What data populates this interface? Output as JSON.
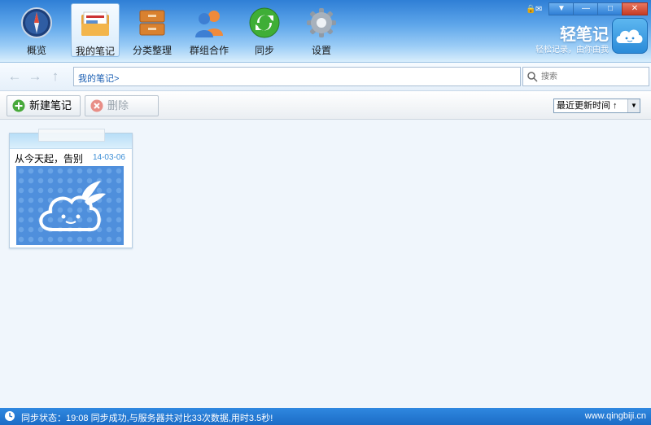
{
  "toolbar": {
    "items": [
      {
        "label": "概览",
        "icon": "compass-icon"
      },
      {
        "label": "我的笔记",
        "icon": "notes-folder-icon"
      },
      {
        "label": "分类整理",
        "icon": "cabinet-icon"
      },
      {
        "label": "群组合作",
        "icon": "group-icon"
      },
      {
        "label": "同步",
        "icon": "sync-icon"
      },
      {
        "label": "设置",
        "icon": "gear-icon"
      }
    ],
    "active_index": 1
  },
  "brand": {
    "title": "轻笔记",
    "slogan": "轻松记录，由你由我"
  },
  "window": {
    "controls": [
      "lock",
      "dropdown",
      "minimize",
      "maximize",
      "close"
    ],
    "accent": "#2f7fd6"
  },
  "nav": {
    "breadcrumb": "我的笔记>",
    "search_placeholder": "搜索"
  },
  "actions": {
    "new_note": "新建笔记",
    "delete": "删除",
    "sort_value": "最近更新时间 ↑"
  },
  "notes": [
    {
      "title": "从今天起，告别",
      "date": "14-03-06"
    }
  ],
  "status": {
    "text": "同步状态：19:08 同步成功,与服务器共对比33次数据,用时3.5秒!",
    "url": "www.qingbiji.cn"
  }
}
